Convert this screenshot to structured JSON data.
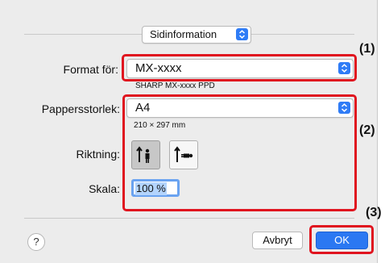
{
  "page_setup_popup": {
    "label": "Sidinformation"
  },
  "format_for": {
    "label": "Format för:",
    "value": "MX-xxxx",
    "description": "SHARP MX-xxxx PPD"
  },
  "paper_size": {
    "label": "Pappersstorlek:",
    "value": "A4",
    "dimensions": "210 × 297 mm"
  },
  "orientation": {
    "label": "Riktning:",
    "options": [
      "portrait",
      "landscape"
    ],
    "selected": "portrait"
  },
  "scale": {
    "label": "Skala:",
    "value": "100 %"
  },
  "buttons": {
    "help": "?",
    "cancel": "Avbryt",
    "ok": "OK"
  },
  "callouts": {
    "one": "(1)",
    "two": "(2)",
    "three": "(3)"
  },
  "colors": {
    "accent": "#2b78f2",
    "callout_border": "#e0141f"
  }
}
